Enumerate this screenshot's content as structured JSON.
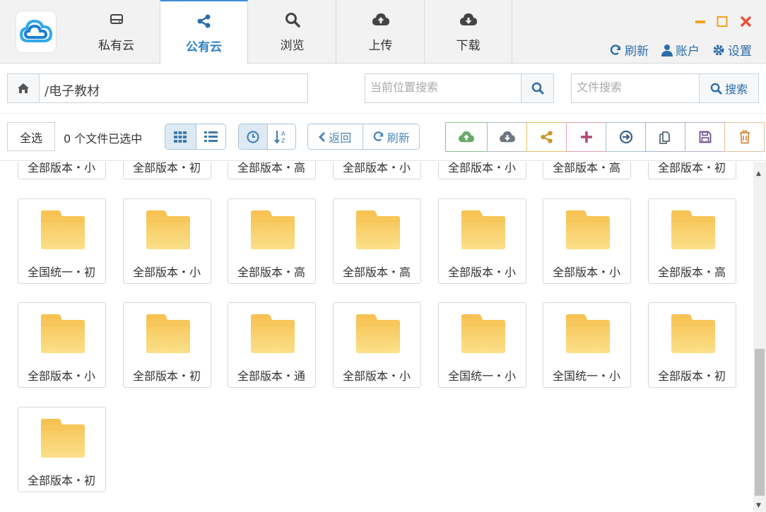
{
  "nav": {
    "tabs": [
      {
        "label": "私有云",
        "icon": "hdd-icon"
      },
      {
        "label": "公有云",
        "icon": "share-icon"
      },
      {
        "label": "浏览",
        "icon": "search-icon"
      },
      {
        "label": "上传",
        "icon": "cloud-upload-icon"
      },
      {
        "label": "下载",
        "icon": "cloud-download-icon"
      }
    ],
    "active": "公有云"
  },
  "header": {
    "refresh_label": "刷新",
    "account_label": "账户",
    "settings_label": "设置"
  },
  "path": {
    "current": "/电子教材"
  },
  "search": {
    "location_placeholder": "当前位置搜索",
    "file_placeholder": "文件搜索",
    "search_button": "搜索"
  },
  "toolbar": {
    "select_all": "全选",
    "selected_status": "0 个文件已选中",
    "back_label": "返回",
    "refresh_label": "刷新"
  },
  "partial_row": [
    "全部版本・小",
    "全部版本・初",
    "全部版本・高",
    "全部版本・小",
    "全部版本・小",
    "全部版本・高",
    "全部版本・初"
  ],
  "files": [
    "全国统一・初",
    "全部版本・小",
    "全部版本・高",
    "全部版本・高",
    "全部版本・小",
    "全部版本・小",
    "全部版本・高",
    "全部版本・小",
    "全部版本・初",
    "全部版本・通",
    "全部版本・小",
    "全国统一・小",
    "全国统一・小",
    "全部版本・初",
    "全部版本・初"
  ],
  "colors": {
    "accent": "#2f7fc4",
    "folder_top": "#f7c04f",
    "folder_bottom": "#fbe08a",
    "close": "#e5533d",
    "minimize": "#f0a31c"
  }
}
